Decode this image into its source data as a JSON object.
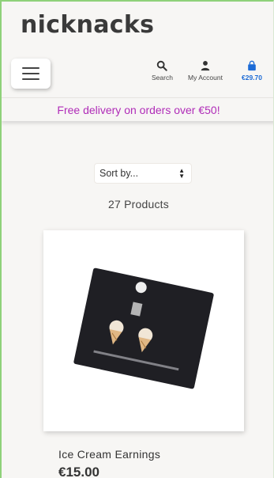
{
  "header": {
    "brand": "nicknacks"
  },
  "nav": {
    "search_label": "Search",
    "account_label": "My Account",
    "bag_total": "€29.70",
    "icons": {
      "menu": "hamburger-icon",
      "search": "search-icon",
      "account": "user-icon",
      "bag": "shopping-bag-icon"
    }
  },
  "promo": {
    "text": "Free delivery on orders over €50!"
  },
  "listing": {
    "sort_value": "Sort by...",
    "product_count": "27 Products"
  },
  "products": [
    {
      "name": "Ice Cream Earnings",
      "price": "€15.00"
    }
  ],
  "colors": {
    "promo_text": "#b02cb8",
    "bag_accent": "#1c6bd6",
    "frame_border": "#8fd17a"
  }
}
